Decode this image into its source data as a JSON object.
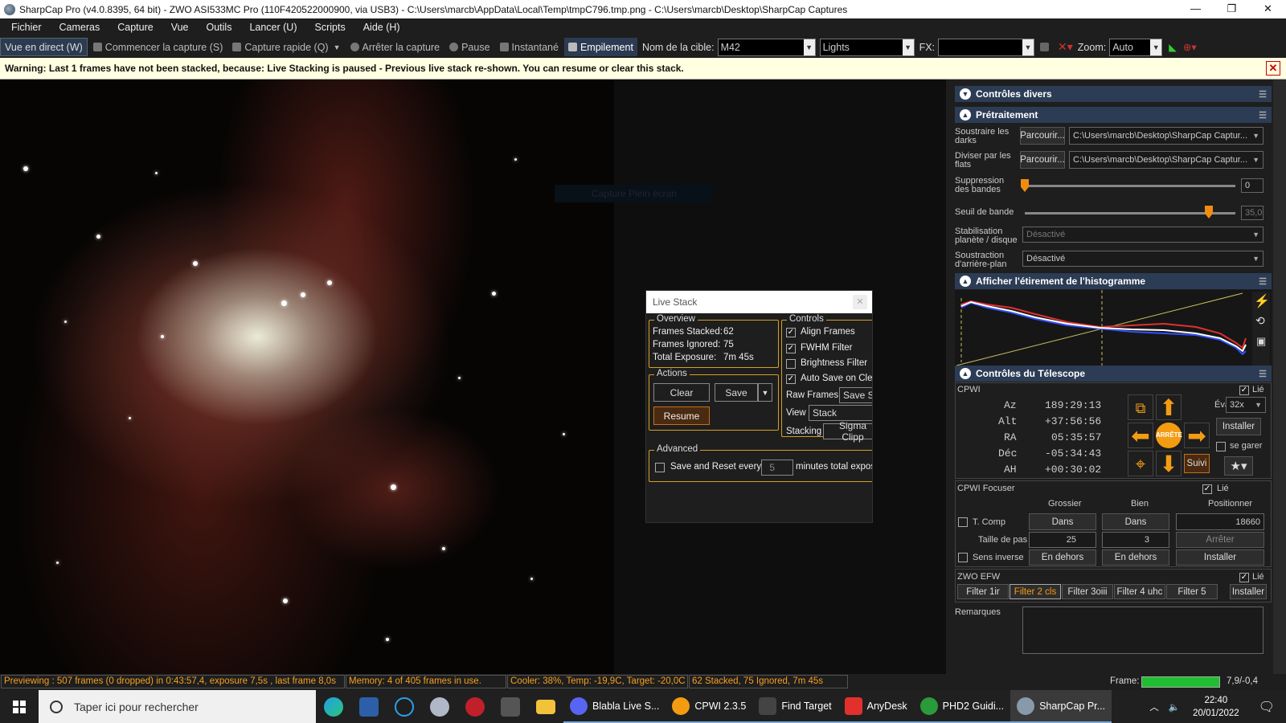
{
  "window": {
    "title": "SharpCap Pro (v4.0.8395, 64 bit) - ZWO ASI533MC Pro (110F420522000900, via USB3) - C:\\Users\\marcb\\AppData\\Local\\Temp\\tmpC796.tmp.png - C:\\Users\\marcb\\Desktop\\SharpCap Captures",
    "minimize": "—",
    "maximize": "❐",
    "close": "✕"
  },
  "menu": [
    "Fichier",
    "Cameras",
    "Capture",
    "Vue",
    "Outils",
    "Lancer (U)",
    "Scripts",
    "Aide (H)"
  ],
  "toolbar": {
    "live_view": "Vue en direct (W)",
    "start_capture": "Commencer la capture (S)",
    "quick_capture": "Capture rapide (Q)",
    "stop_capture": "Arrêter la capture",
    "pause": "Pause",
    "snapshot": "Instantané",
    "stacking": "Empilement",
    "target_label": "Nom de la cible:",
    "target_value": "M42",
    "frame_type": "Lights",
    "fx_label": "FX:",
    "fx_value": "",
    "zoom_label": "Zoom:",
    "zoom_value": "Auto"
  },
  "warning": "Warning: Last 1 frames have not been stacked, because: Live Stacking is paused - Previous live stack re-shown. You can resume or clear this stack.",
  "viewer": {
    "ghost_text": "Capture Plein écran"
  },
  "live_stack": {
    "title": "Live Stack",
    "overview_title": "Overview",
    "frames_stacked_label": "Frames Stacked:",
    "frames_stacked": "62",
    "frames_ignored_label": "Frames Ignored:",
    "frames_ignored": "75",
    "total_exposure_label": "Total Exposure:",
    "total_exposure": "7m 45s",
    "actions_title": "Actions",
    "clear": "Clear",
    "save": "Save",
    "resume": "Resume",
    "controls_title": "Controls",
    "align_frames": "Align Frames",
    "fwhm_filter": "FWHM Filter",
    "brightness_filter": "Brightness Filter",
    "auto_save": "Auto Save on Clea",
    "raw_frames_label": "Raw Frames",
    "raw_frames_value": "Save St",
    "view_label": "View",
    "view_value": "Stack",
    "stacking_label": "Stacking",
    "stacking_value": "Sigma Clipp",
    "advanced_title": "Advanced",
    "save_reset_label": "Save and Reset every",
    "save_reset_value": "5",
    "save_reset_suffix": "minutes total exposu"
  },
  "panel": {
    "misc_title": "Contrôles divers",
    "preproc_title": "Prétraitement",
    "subtract_darks": "Soustraire les darks",
    "divide_flats": "Diviser par les flats",
    "browse": "Parcourir...",
    "darks_path": "C:\\Users\\marcb\\Desktop\\SharpCap Captur...",
    "flats_path": "C:\\Users\\marcb\\Desktop\\SharpCap Captur...",
    "banding_suppression": "Suppression des bandes",
    "banding_value": "0",
    "banding_threshold": "Seuil de bande",
    "threshold_value": "35,0",
    "planet_stab": "Stabilisation planète / disque",
    "planet_stab_value": "Désactivé",
    "bg_subtract": "Soustraction d'arrière-plan",
    "bg_subtract_value": "Désactivé",
    "histo_title": "Afficher l'étirement de l'histogramme",
    "telescope_title": "Contrôles du Télescope",
    "cpwi_label": "CPWI",
    "linked": "Lié",
    "az_label": "Az",
    "az_value": "189:29:13",
    "alt_label": "Alt",
    "alt_value": "+37:56:56",
    "ra_label": "RA",
    "ra_value": "05:35:57",
    "dec_label": "Déc",
    "dec_value": "-05:34:43",
    "ah_label": "AH",
    "ah_value": "+00:30:02",
    "rate_label": "Évaluer:",
    "rate_value": "32x",
    "stop_label": "ARRÊTE",
    "install": "Installer",
    "park": "se garer",
    "track": "Suivi",
    "focuser_label": "CPWI Focuser",
    "coarse": "Grossier",
    "fine": "Bien",
    "position": "Positionner",
    "tcomp": "T. Comp",
    "in": "Dans",
    "position_value": "18660",
    "step_size": "Taille de pas",
    "coarse_step": "25",
    "fine_step": "3",
    "stop": "Arrêter",
    "reverse": "Sens inverse",
    "out": "En dehors",
    "efw_label": "ZWO EFW",
    "filters": [
      "Filter 1ir",
      "Filter 2 cls",
      "Filter 3oiii",
      "Filter 4 uhc",
      "Filter 5"
    ],
    "notes_label": "Remarques"
  },
  "status": {
    "preview": "Previewing : 507 frames (0 dropped) in 0:43:57,4, exposure 7,5s , last frame 8,0s",
    "memory": "Memory: 4 of 405 frames in use.",
    "cooler": "Cooler: 38%, Temp: -19,9C, Target: -20,0C",
    "stacked": "62 Stacked, 75 Ignored, 7m 45s",
    "frame_label": "Frame:",
    "frame_value": "7,9/-0,4"
  },
  "taskbar": {
    "search": "Taper ici pour rechercher",
    "apps": [
      "Blabla Live S...",
      "CPWI 2.3.5",
      "Find Target",
      "AnyDesk",
      "PHD2 Guidi...",
      "SharpCap Pr..."
    ],
    "time": "22:40",
    "date": "20/01/2022"
  }
}
